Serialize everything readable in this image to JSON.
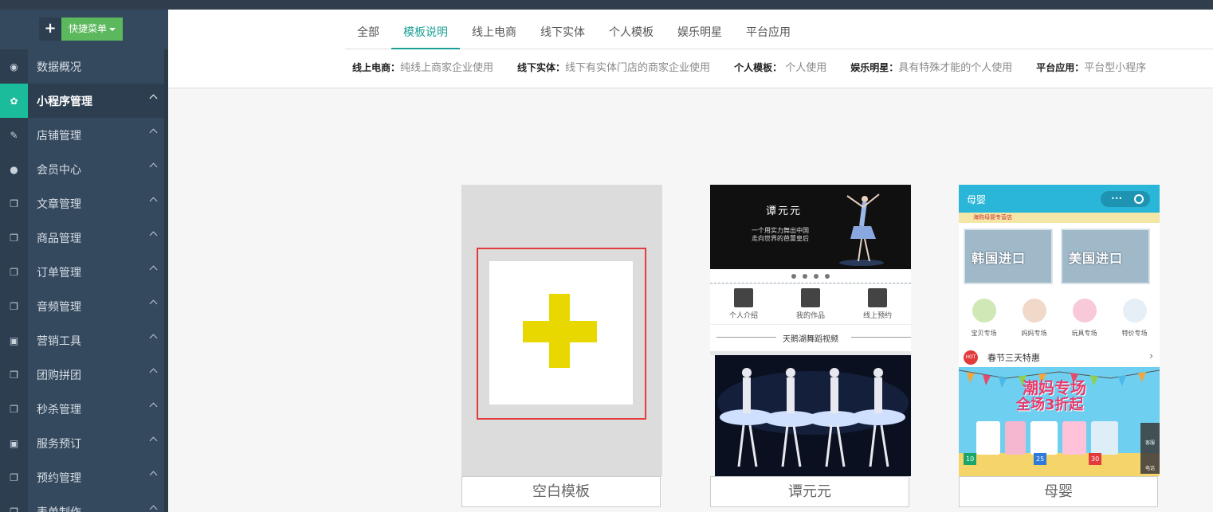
{
  "quick_menu": {
    "plus": "+",
    "label": "快捷菜单"
  },
  "sidebar": {
    "items": [
      {
        "label": "数据概况",
        "icon": "dashboard-icon",
        "glyph": "◉",
        "active": false
      },
      {
        "label": "小程序管理",
        "icon": "gear-icon",
        "glyph": "✿",
        "active": true
      },
      {
        "label": "店铺管理",
        "icon": "wand-icon",
        "glyph": "✎",
        "active": false
      },
      {
        "label": "会员中心",
        "icon": "user-icon",
        "glyph": "●",
        "active": false
      },
      {
        "label": "文章管理",
        "icon": "copy-icon",
        "glyph": "❐",
        "active": false
      },
      {
        "label": "商品管理",
        "icon": "copy-icon",
        "glyph": "❐",
        "active": false
      },
      {
        "label": "订单管理",
        "icon": "copy-icon",
        "glyph": "❐",
        "active": false
      },
      {
        "label": "音频管理",
        "icon": "copy-icon",
        "glyph": "❐",
        "active": false
      },
      {
        "label": "营销工具",
        "icon": "gift-icon",
        "glyph": "▣",
        "active": false
      },
      {
        "label": "团购拼团",
        "icon": "copy-icon",
        "glyph": "❐",
        "active": false
      },
      {
        "label": "秒杀管理",
        "icon": "copy-icon",
        "glyph": "❐",
        "active": false
      },
      {
        "label": "服务预订",
        "icon": "gift-icon",
        "glyph": "▣",
        "active": false
      },
      {
        "label": "预约管理",
        "icon": "copy-icon",
        "glyph": "❐",
        "active": false
      },
      {
        "label": "表单制作",
        "icon": "copy-icon",
        "glyph": "❐",
        "active": false
      }
    ]
  },
  "tabs": [
    {
      "label": "全部",
      "active": false
    },
    {
      "label": "模板说明",
      "active": true
    },
    {
      "label": "线上电商",
      "active": false
    },
    {
      "label": "线下实体",
      "active": false
    },
    {
      "label": "个人模板",
      "active": false
    },
    {
      "label": "娱乐明星",
      "active": false
    },
    {
      "label": "平台应用",
      "active": false
    }
  ],
  "descriptions": [
    {
      "key": "线上电商：",
      "value": "纯线上商家企业使用"
    },
    {
      "key": "线下实体：",
      "value": "线下有实体门店的商家企业使用"
    },
    {
      "key": "个人模板：",
      "value": "  个人使用"
    },
    {
      "key": "娱乐明星：",
      "value": "具有特殊才能的个人使用"
    },
    {
      "key": "平台应用：",
      "value": "平台型小程序"
    }
  ],
  "templates": {
    "blank": {
      "caption": "空白模板"
    },
    "dancer": {
      "caption": "谭元元",
      "banner_name": "谭元元",
      "banner_line1": "一个用实力舞出中国",
      "banner_line2": "走向世界的芭蕾皇后",
      "icons": [
        "个人介绍",
        "我的作品",
        "线上预约"
      ],
      "section_title": "天鹅湖舞蹈视频"
    },
    "baby": {
      "caption": "母婴",
      "header_title": "母婴",
      "capsule_dots": "•••",
      "strip_text": "海购母婴专营店",
      "promo1": "韩国进口",
      "promo2": "美国进口",
      "categories": [
        "宝贝专场",
        "妈妈专场",
        "玩具专场",
        "特价专场"
      ],
      "hot_badge": "HOT",
      "hot_title": "春节三天特惠",
      "hot_arrow": "›",
      "sale_line1": "潮妈专场",
      "sale_line2": "全场3折起",
      "badges": [
        "10",
        "25",
        "30"
      ],
      "side_1": "客服",
      "side_2": "电话"
    }
  }
}
